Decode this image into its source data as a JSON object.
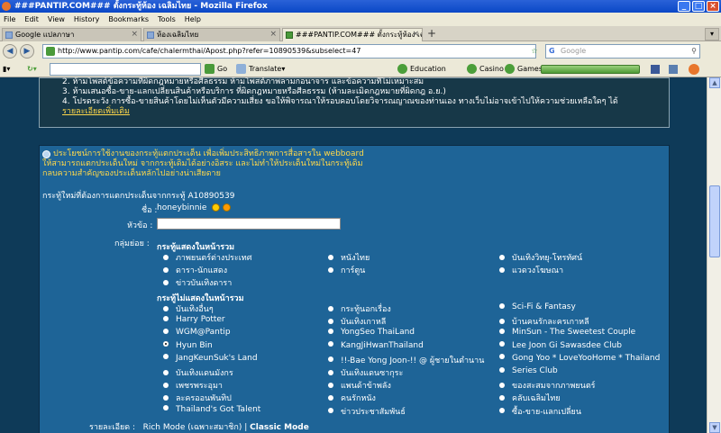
{
  "window": {
    "title": "###PANTIP.COM### ตั้งกระทู้ห้อง เฉลิมไทย - Mozilla Firefox"
  },
  "menu": [
    "File",
    "Edit",
    "View",
    "History",
    "Bookmarks",
    "Tools",
    "Help"
  ],
  "tabs": [
    {
      "label": "Google แปลภาษา"
    },
    {
      "label": "ห้องเฉลิมไทย"
    },
    {
      "label": "###PANTIP.COM### ตั้งกระทู้ห้อง เฉลิมไทย"
    }
  ],
  "nav": {
    "url": "http://www.pantip.com/cafe/chalermthai/Apost.php?refer=10890539&subselect=47",
    "search_placeholder": "Google"
  },
  "toolbar": {
    "go": "Go",
    "translate": "Translate",
    "education": "Education",
    "casino": "Casino",
    "games": "Games"
  },
  "notes": {
    "line1": "2. ห้ามโพสต์ข้อความที่ผิดกฎหมายหรือศีลธรรม ห้ามโพสต์ภาพลามกอนาจาร และข้อความที่ไม่เหมาะสม",
    "line2": "3. ห้ามเสนอซื้อ-ขาย-แลกเปลี่ยนสินค้าหรือบริการ ที่ผิดกฎหมายหรือศีลธรรม (ห้ามละเมิดกฎหมายที่ผิดกฎ อ.ย.)",
    "line3": "4. โปรดระวัง การซื้อ-ขายสินค้าโดยไม่เห็นตัวมีความเสี่ยง ขอให้พิจารณาให้รอบคอบโดยวิจารณญาณของท่านเอง ทางเว็บไม่อาจเข้าไปให้ความช่วยเหลือใดๆ ได้",
    "more_link": "รายละเอียดเพิ่มเติม"
  },
  "form": {
    "notice1": "ประโยชน์การใช้งานของกระทู้แตกประเด็น เพื่อเพิ่มประสิทธิภาพการสื่อสารใน webboard",
    "notice2": "ให้สามารถแตกประเด็นใหม่ จากกระทู้เดิมได้อย่างอิสระ และไม่ทำให้ประเด็นใหม่ในกระทู้เดิม",
    "notice3": "กลบความสำคัญของประเด็นหลักไปอย่างน่าเสียดาย",
    "split_info": "กระทู้ใหม่ที่ต้องการแตกประเด็นจากกระทู้ A10890539",
    "name_label": "ชื่อ :",
    "name_value": "honeybinnie",
    "title_label": "หัวข้อ :",
    "group_label": "กลุ่มย่อย :",
    "section_front": "กระทู้แสดงในหน้ารวม",
    "section_hidden": "กระทู้ไม่แสดงในหน้ารวม",
    "front_options": [
      "ภาพยนตร์ต่างประเทศ",
      "หนังไทย",
      "บันเทิงวิทยุ-โทรทัศน์",
      "ดารา-นักแสดง",
      "การ์ตูน",
      "แวดวงโฆษณา",
      "ข่าวบันเทิงดารา"
    ],
    "hidden_options": [
      "บันเทิงอื่นๆ",
      "กระทู้นอกเรื่อง",
      "Sci-Fi & Fantasy",
      "Harry Potter",
      "บันเทิงเกาหลี",
      "บ้านคนรักละครเกาหลี",
      "WGM@Pantip",
      "YongSeo ThaiLand",
      "MinSun - The Sweetest Couple",
      "Hyun Bin",
      "KangJiHwanThailand",
      "Lee Joon Gi Sawasdee Club",
      "JangKeunSuk's Land",
      "!!-Bae Yong Joon-!! @ ผู้ชายในตำนาน",
      "Gong Yoo * LoveYooHome * Thailand",
      "บันเทิงแดนมังกร",
      "บันเทิงแดนซากุระ",
      "Series Club",
      "เพชรพระอุมา",
      "แพนด้าข้าพลัง",
      "ของสะสมจากภาพยนตร์",
      "ละครออนพันทิป",
      "คนรักหนัง",
      "คลับเฉลิมไทย",
      "Thailand's Got Talent",
      "ข่าวประชาสัมพันธ์",
      "ซื้อ-ขาย-แลกเปลี่ยน"
    ],
    "selected_hidden_index": 9,
    "detail_label": "รายละเอียด :",
    "rich_mode": "Rich Mode (เฉพาะสมาชิก) |",
    "classic_mode": "Classic Mode"
  }
}
